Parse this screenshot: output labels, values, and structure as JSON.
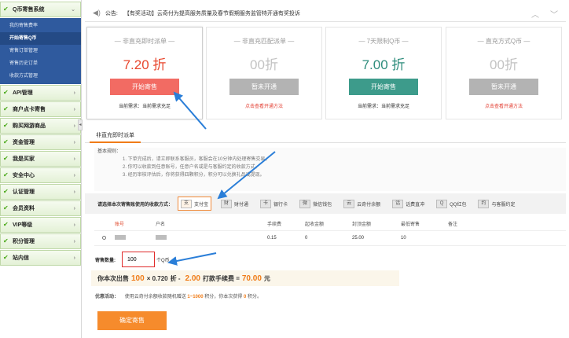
{
  "sidebar": {
    "top_section": "Q币寄售系统",
    "sub_items": [
      "我的寄售费率",
      "开始寄售Q币",
      "寄售订单管理",
      "寄售历史订单",
      "收款方式管理"
    ],
    "sections": [
      "API管理",
      "商户点卡寄售",
      "购买网游商品",
      "资金管理",
      "我是买家",
      "安全中心",
      "认证管理",
      "会员资料",
      "VIP等级",
      "积分管理",
      "站内信"
    ]
  },
  "notice": {
    "label": "公告:",
    "text": "【有奖活动】云奇付为提高服务质量及春节假期服务监管特开通有奖投诉"
  },
  "cards": [
    {
      "title": "— 非直充即时派单 —",
      "discount": "7.20 折",
      "button": "开始寄售",
      "bottom": "当前需求：当前需求充足",
      "color": "#f26b63"
    },
    {
      "title": "— 非直充匹配派单 —",
      "discount": "00折",
      "button": "暂未开通",
      "bottom": "点击查看开通方法",
      "color": "#b3b3b3"
    },
    {
      "title": "— 7天限制Q币 —",
      "discount": "7.00 折",
      "button": "开始寄售",
      "bottom": "当前需求：当前需求充足",
      "color": "#3d9b8b"
    },
    {
      "title": "— 直充方式Q币 —",
      "discount": "00折",
      "button": "暂未开通",
      "bottom": "点击查看开通方法",
      "color": "#b3b3b3"
    }
  ],
  "tab": "非直充即时派单",
  "rules": {
    "heading": "基本规则：",
    "items": [
      "1. 下单完成后，请立即联系客服员，客服会在10分钟内处理寄售交易。",
      "2. 你可以收款到任意账号，任意户名或是与客服约定的收款方式。",
      "3. 经历审核评估后，你将获得四颗积分，积分可以兑换礼品或提现。"
    ]
  },
  "payment": {
    "label": "请选择本次寄售账使用的收款方式：",
    "methods": [
      {
        "icon": "alipay-icon",
        "glyph": "支",
        "label": "支付宝"
      },
      {
        "icon": "tenpay-icon",
        "glyph": "财",
        "label": "财付通"
      },
      {
        "icon": "bankcard-icon",
        "glyph": "卡",
        "label": "银行卡"
      },
      {
        "icon": "wechat-icon",
        "glyph": "微",
        "label": "微信钱包"
      },
      {
        "icon": "cloud-icon",
        "glyph": "云",
        "label": "云奇付余额"
      },
      {
        "icon": "phone-icon",
        "glyph": "话",
        "label": "话费直冲"
      },
      {
        "icon": "qq-icon",
        "glyph": "Q",
        "label": "QQ红包"
      },
      {
        "icon": "chat-icon",
        "glyph": "约",
        "label": "与客服约定"
      }
    ]
  },
  "table": {
    "headers": [
      "账号",
      "户名",
      "手续费",
      "起收金额",
      "封顶金额",
      "最低寄售",
      "备注"
    ],
    "rows": [
      {
        "fee": "0.15",
        "min": "0",
        "cap": "25.00",
        "low": "10"
      }
    ]
  },
  "quantity": {
    "label": "寄售数量:",
    "value": "100",
    "unit": "个Q币"
  },
  "calc": {
    "prefix": "你本次出售",
    "qty": "100",
    "mul": "× 0.720",
    "unit1": "折 -",
    "fee": "2.00",
    "mid": "打款手续费 =",
    "total": "70.00",
    "unit2": "元"
  },
  "promo": {
    "label": "优惠活动：",
    "text": "使用云奇付余额收款随机赠送",
    "range": "1~1000",
    "mid": "积分，你本次获得",
    "pts": "0",
    "end": "积分。"
  },
  "confirm_button": "确定寄售"
}
